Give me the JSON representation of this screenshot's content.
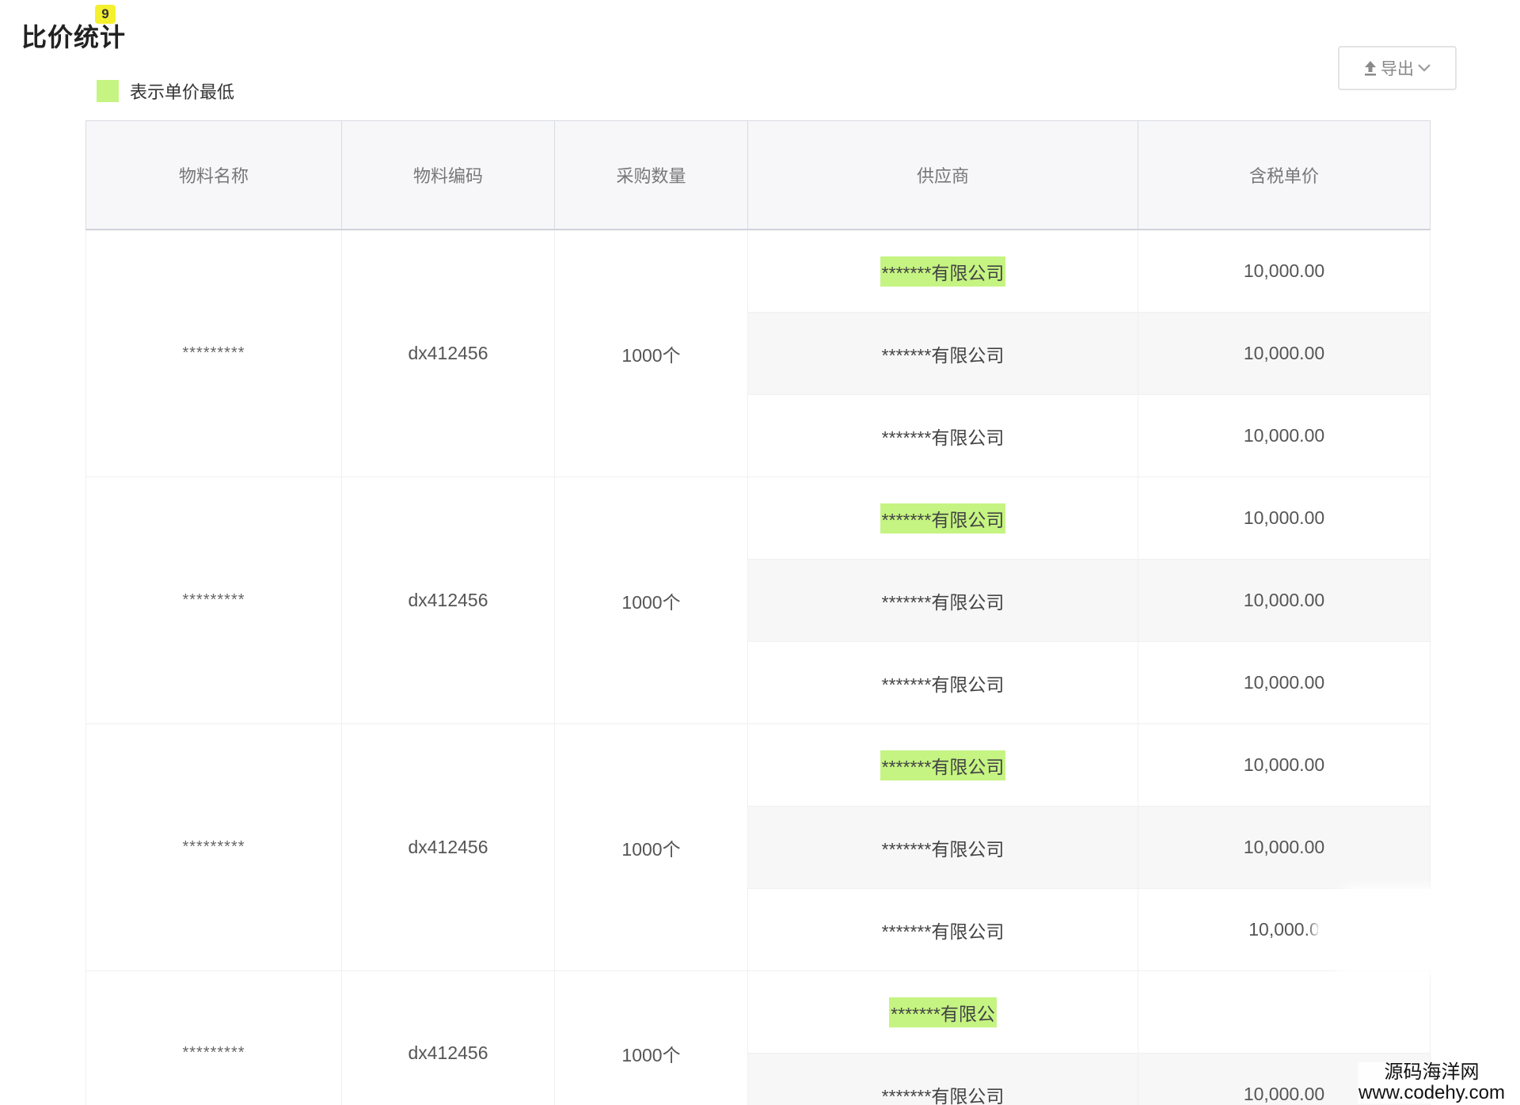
{
  "page": {
    "title": "比价统计",
    "badge": "9"
  },
  "legend": {
    "text": "表示单价最低",
    "color": "#c5f482"
  },
  "toolbar": {
    "export_label": "导出",
    "export_icon": "upload-icon",
    "dropdown_icon": "chevron-down-icon"
  },
  "table": {
    "headers": [
      "物料名称",
      "物料编码",
      "采购数量",
      "供应商",
      "含税单价"
    ],
    "groups": [
      {
        "name": "*********",
        "code": "dx412456",
        "qty": "1000个",
        "rows": [
          {
            "vendor": "*******有限公司",
            "price": "10,000.00",
            "lowest": true
          },
          {
            "vendor": "*******有限公司",
            "price": "10,000.00",
            "lowest": false
          },
          {
            "vendor": "*******有限公司",
            "price": "10,000.00",
            "lowest": false
          }
        ]
      },
      {
        "name": "*********",
        "code": "dx412456",
        "qty": "1000个",
        "rows": [
          {
            "vendor": "*******有限公司",
            "price": "10,000.00",
            "lowest": true
          },
          {
            "vendor": "*******有限公司",
            "price": "10,000.00",
            "lowest": false
          },
          {
            "vendor": "*******有限公司",
            "price": "10,000.00",
            "lowest": false
          }
        ]
      },
      {
        "name": "*********",
        "code": "dx412456",
        "qty": "1000个",
        "rows": [
          {
            "vendor": "*******有限公司",
            "price": "10,000.00",
            "lowest": true
          },
          {
            "vendor": "*******有限公司",
            "price": "10,000.00",
            "lowest": false
          },
          {
            "vendor": "*******有限公司",
            "price": "10,000.0",
            "lowest": false
          }
        ]
      },
      {
        "name": "*********",
        "code": "dx412456",
        "qty": "1000个",
        "rows": [
          {
            "vendor": "*******有限公",
            "price": "",
            "lowest": true
          },
          {
            "vendor": "*******有限公司",
            "price": "10,000.00",
            "lowest": false
          }
        ]
      }
    ]
  },
  "watermark": {
    "line1": "源码海洋网",
    "line2": "www.codehy.com"
  }
}
